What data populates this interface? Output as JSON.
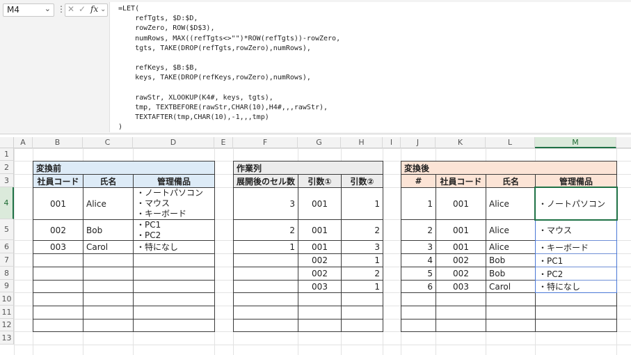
{
  "name_box": "M4",
  "formula_bar": {
    "fx_label": "fx",
    "formula": "=LET(\n    refTgts, $D:$D,\n    rowZero, ROW($D$3),\n    numRows, MAX((refTgts<>\"\")*ROW(refTgts))-rowZero,\n    tgts, TAKE(DROP(refTgts,rowZero),numRows),\n\n    refKeys, $B:$B,\n    keys, TAKE(DROP(refKeys,rowZero),numRows),\n\n    rawStr, XLOOKUP(K4#, keys, tgts),\n    tmp, TEXTBEFORE(rawStr,CHAR(10),H4#,,,rawStr),\n    TEXTAFTER(tmp,CHAR(10),-1,,,tmp)\n)"
  },
  "columns": [
    "A",
    "B",
    "C",
    "D",
    "E",
    "F",
    "G",
    "H",
    "I",
    "J",
    "K",
    "L",
    "M"
  ],
  "rows": [
    "1",
    "2",
    "3",
    "4",
    "5",
    "6",
    "7",
    "8",
    "9",
    "10",
    "11",
    "12",
    "13"
  ],
  "colors": {
    "before_header": "#ddebf7",
    "work_header": "#ececec",
    "after_header": "#fce4d6",
    "selected_header": "#dbeadb",
    "selection_border": "#1e7145"
  },
  "before": {
    "title": "変換前",
    "headers": [
      "社員コード",
      "氏名",
      "管理備品"
    ],
    "rows": [
      [
        "001",
        "Alice",
        "・ノートパソコン\n・マウス\n・キーボード"
      ],
      [
        "002",
        "Bob",
        "・PC1\n・PC2"
      ],
      [
        "003",
        "Carol",
        "・特になし"
      ]
    ]
  },
  "work": {
    "title": "作業列",
    "headers": [
      "展開後のセル数",
      "引数①",
      "引数②"
    ],
    "rows": [
      [
        "3",
        "001",
        "1"
      ],
      [
        "2",
        "001",
        "2"
      ],
      [
        "1",
        "001",
        "3"
      ],
      [
        "",
        "002",
        "1"
      ],
      [
        "",
        "002",
        "2"
      ],
      [
        "",
        "003",
        "1"
      ]
    ]
  },
  "after": {
    "title": "変換後",
    "headers": [
      "#",
      "社員コード",
      "氏名",
      "管理備品"
    ],
    "rows": [
      [
        "1",
        "001",
        "Alice",
        "・ノートパソコン"
      ],
      [
        "2",
        "001",
        "Alice",
        "・マウス"
      ],
      [
        "3",
        "001",
        "Alice",
        "・キーボード"
      ],
      [
        "4",
        "002",
        "Bob",
        "・PC1"
      ],
      [
        "5",
        "002",
        "Bob",
        "・PC2"
      ],
      [
        "6",
        "003",
        "Carol",
        "・特になし"
      ]
    ]
  }
}
